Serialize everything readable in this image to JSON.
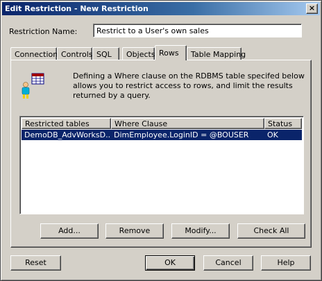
{
  "window": {
    "title": "Edit Restriction - New Restriction",
    "close_glyph": "×"
  },
  "form": {
    "name_label": "Restriction Name:",
    "name_value": "Restrict to a User's own sales"
  },
  "tabs": [
    {
      "label": "Connection"
    },
    {
      "label": "Controls"
    },
    {
      "label": "SQL"
    },
    {
      "label": "Objects"
    },
    {
      "label": "Rows",
      "active": true
    },
    {
      "label": "Table Mapping"
    }
  ],
  "rows_panel": {
    "icon": "user-table-icon",
    "description": "Defining a Where clause on the RDBMS table specifed below allows you to restrict access to rows, and limit the results returned by a query.",
    "table": {
      "columns": [
        "Restricted tables",
        "Where Clause",
        "Status"
      ],
      "rows": [
        {
          "table": "DemoDB_AdvWorksD...",
          "where": "DimEmployee.LoginID = @BOUSER",
          "status": "OK"
        }
      ]
    },
    "buttons": {
      "add": "Add...",
      "remove": "Remove",
      "modify": "Modify...",
      "check_all": "Check All"
    }
  },
  "footer": {
    "reset": "Reset",
    "ok": "OK",
    "cancel": "Cancel",
    "help": "Help"
  },
  "colors": {
    "title_bar": "#0a246a",
    "selection": "#0a246a",
    "face": "#d4d0c8"
  }
}
